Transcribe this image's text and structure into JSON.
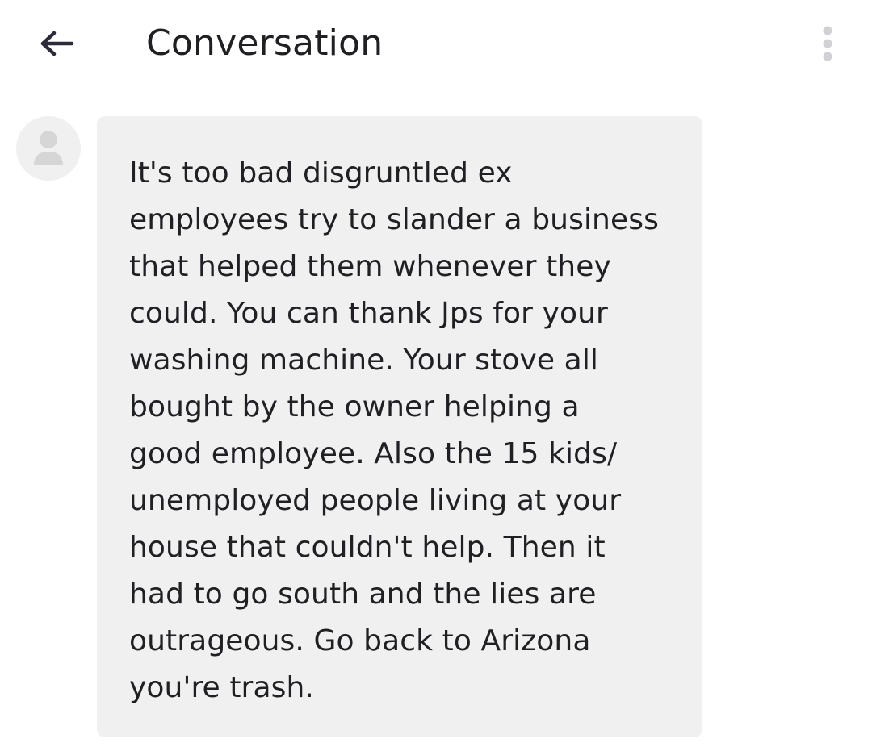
{
  "header": {
    "title": "Conversation",
    "back_icon": "arrow-left-icon",
    "more_icon": "more-vertical-icon"
  },
  "message": {
    "avatar_icon": "user-icon",
    "lines": [
      "It's too bad disgruntled ex",
      "employees try to slander a business",
      "that helped them whenever they",
      "could. You can thank Jps for your",
      "washing machine. Your stove all",
      "bought by the owner helping a",
      "good employee. Also the 15 kids/",
      "unemployed people living at your",
      "house that couldn't help.  Then it",
      "had to go south and the lies are",
      "outrageous. Go back to Arizona",
      "you're trash."
    ]
  },
  "colors": {
    "background": "#ffffff",
    "bubble": "#f0f0f0",
    "text": "#1f1f24",
    "icon_dark": "#2b2b3a",
    "icon_light": "#d2d2d6",
    "avatar_glyph": "#d6d6d6"
  }
}
